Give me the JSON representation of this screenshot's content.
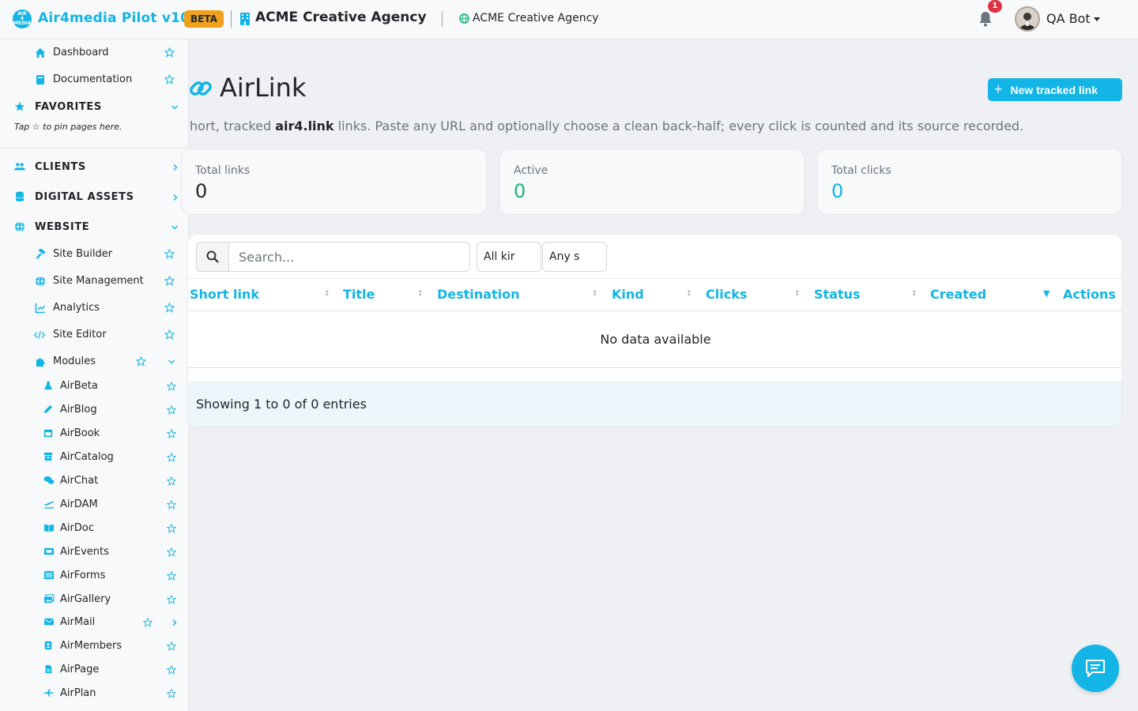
{
  "app": {
    "brand": "Air4media Pilot v10",
    "badge": "BETA",
    "organization": "ACME Creative Agency",
    "site": "ACME Creative Agency",
    "notification_count": "1",
    "user": "QA Bot",
    "accent_color": "#12b5e5"
  },
  "sidebar": {
    "top_items": [
      {
        "label": "Dashboard",
        "icon": "home-icon"
      },
      {
        "label": "Documentation",
        "icon": "book-icon"
      }
    ],
    "favorites": {
      "label": "FAVORITES",
      "hint": "Tap ☆ to pin pages here."
    },
    "sections": {
      "clients": "CLIENTS",
      "digital_assets": "DIGITAL ASSETS",
      "website": "WEBSITE"
    },
    "website_items": [
      {
        "label": "Site Builder",
        "icon": "hammer-icon"
      },
      {
        "label": "Site Management",
        "icon": "globe-icon"
      },
      {
        "label": "Analytics",
        "icon": "chart-icon"
      },
      {
        "label": "Site Editor",
        "icon": "code-icon"
      },
      {
        "label": "Modules",
        "icon": "puzzle-icon"
      }
    ],
    "modules": [
      {
        "label": "AirBeta",
        "icon": "flask-icon"
      },
      {
        "label": "AirBlog",
        "icon": "pen-icon"
      },
      {
        "label": "AirBook",
        "icon": "calendar-icon"
      },
      {
        "label": "AirCatalog",
        "icon": "box-icon"
      },
      {
        "label": "AirChat",
        "icon": "chat-icon"
      },
      {
        "label": "AirDAM",
        "icon": "plane-icon"
      },
      {
        "label": "AirDoc",
        "icon": "book-open-icon"
      },
      {
        "label": "AirEvents",
        "icon": "ticket-icon"
      },
      {
        "label": "AirForms",
        "icon": "list-icon"
      },
      {
        "label": "AirGallery",
        "icon": "images-icon"
      },
      {
        "label": "AirMail",
        "icon": "envelope-icon"
      },
      {
        "label": "AirMembers",
        "icon": "id-card-icon"
      },
      {
        "label": "AirPage",
        "icon": "file-icon"
      },
      {
        "label": "AirPlan",
        "icon": "plane-icon"
      }
    ]
  },
  "page": {
    "title": "AirLink",
    "new_button": "New tracked link",
    "intro_prefix": "hort, tracked ",
    "intro_bold": "air4.link",
    "intro_suffix": " links. Paste any URL and optionally choose a clean back-half; every click is counted and its source recorded."
  },
  "stats": [
    {
      "label": "Total links",
      "value": "0",
      "color": "#212529"
    },
    {
      "label": "Active",
      "value": "0",
      "color": "#20b27a"
    },
    {
      "label": "Total clicks",
      "value": "0",
      "color": "#12b5e5"
    }
  ],
  "table": {
    "search_placeholder": "Search...",
    "filter_kind": "All kir",
    "filter_status": "Any s",
    "columns": [
      "Short link",
      "Title",
      "Destination",
      "Kind",
      "Clicks",
      "Status",
      "Created",
      "Actions"
    ],
    "empty_text": "No data available",
    "footer": "Showing 1 to 0 of 0 entries"
  }
}
